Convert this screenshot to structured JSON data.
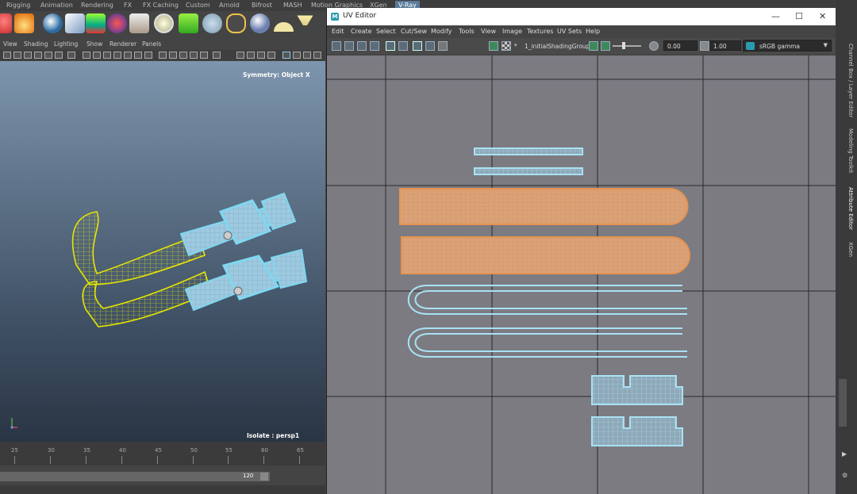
{
  "shelf_tabs": [
    {
      "label": "Rigging",
      "active": false
    },
    {
      "label": "Animation",
      "active": false
    },
    {
      "label": "Rendering",
      "active": false
    },
    {
      "label": "FX",
      "active": false
    },
    {
      "label": "FX Caching",
      "active": false
    },
    {
      "label": "Custom",
      "active": false
    },
    {
      "label": "Arnold",
      "active": false
    },
    {
      "label": "Bifrost",
      "active": false
    },
    {
      "label": "MASH",
      "active": false
    },
    {
      "label": "Motion Graphics",
      "active": false
    },
    {
      "label": "XGen",
      "active": false
    },
    {
      "label": "V-Ray",
      "active": true
    }
  ],
  "shelf_icons": [
    "red-sphere-icon",
    "fire-icon",
    "blue-sphere-icon",
    "light-icon",
    "cone-icon",
    "gradient-icon",
    "camera-icon",
    "grid-icon",
    "fur-icon",
    "gear-icon",
    "curve-icon",
    "metal-sphere-icon",
    "dome-light-icon",
    "spot-light-icon"
  ],
  "viewport": {
    "menus": [
      "View",
      "Shading",
      "Lighting",
      "Show",
      "Renderer",
      "Panels"
    ],
    "symmetry_label": "Symmetry: Object X",
    "isolate_label": "Isolate : persp1"
  },
  "timeline": {
    "ticks": [
      "25",
      "30",
      "35",
      "40",
      "45",
      "50",
      "55",
      "60",
      "65"
    ],
    "range_end": "120"
  },
  "uv_editor": {
    "title": "UV Editor",
    "window_controls": {
      "minimize": "—",
      "maximize": "☐",
      "close": "✕"
    },
    "menus": [
      "Edit",
      "Create",
      "Select",
      "Cut/Sew",
      "Modify",
      "Tools",
      "View",
      "Image",
      "Textures",
      "UV Sets",
      "Help"
    ],
    "shading_group": "1_initialShadingGroup",
    "exposure_value": "0.00",
    "gamma_value": "1.00",
    "color_space": "sRGB gamma"
  },
  "right_rail": {
    "labels": [
      "Channel Box / Layer Editor",
      "Modeling Toolkit",
      "Attribute Editor",
      "XGen"
    ]
  },
  "colors": {
    "viewport_wire": "#e6e600",
    "selected_wire": "#7fd7f0",
    "uv_orange": "#e59450",
    "uv_blue": "#a8e2f3",
    "vray_tab": "#5a7a9a"
  }
}
